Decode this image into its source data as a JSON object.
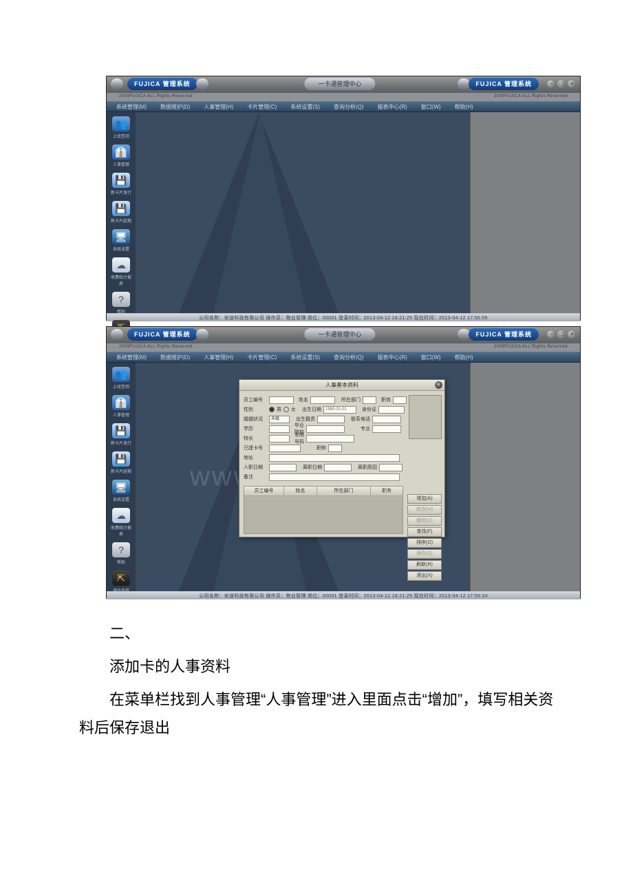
{
  "brand": "FUJICA 管理系统",
  "copyright": "2009FUJICA ALL Rights Reserved",
  "center_title": "一卡通管理中心",
  "winbuttons": {
    "min": "−",
    "max": "□",
    "close": "×"
  },
  "menus": {
    "m0": "系统管理(M)",
    "m1": "数据维护(D)",
    "m2": "人事管理(H)",
    "m3": "卡片管理(C)",
    "m4": "系统设置(S)",
    "m5": "查询分析(Q)",
    "m6": "报表中心(R)",
    "m7": "窗口(W)",
    "m8": "帮助(H)"
  },
  "sidebar": {
    "i0": {
      "glyph": "👥",
      "label": "上班签到"
    },
    "i1": {
      "glyph": "👔",
      "label": "人事管理"
    },
    "i2": {
      "glyph": "💾",
      "label": "新卡片发行"
    },
    "i3": {
      "glyph": "💾",
      "label": "新卡片延期"
    },
    "i4": {
      "glyph": "🖥",
      "label": "系统设置"
    },
    "i5": {
      "glyph": "☁",
      "label": "收费统计报表"
    },
    "i6": {
      "glyph": "?",
      "label": "帮助"
    },
    "i7": {
      "glyph": "⇱",
      "label": "退出系统"
    }
  },
  "status1": "公司名称：安道科技有限公司   操作员：物业管理   岗位：00001   登录时间：2013-04-12 18:21:25   现在时间：2013-04-12 17:56:56",
  "status2": "公司名称：安道科技有限公司   操作员：物业管理   岗位：00001   登录时间：2013-04-12 18:21:25   现在时间：2013-04-12 17:59:34",
  "watermark": "www.bdocx.com",
  "dialog": {
    "title": "人事基本资料",
    "labels": {
      "empno": "员工编号",
      "name": "姓名",
      "dept": "所在部门",
      "job": "职务",
      "sex": "性别",
      "sex_m": "男",
      "sex_f": "女",
      "birth": "出生日期",
      "birth_val": "1980-01-01",
      "idcard": "身份证",
      "marital": "婚姻状况",
      "marital_val": "未婚",
      "native": "出生籍贯",
      "phone": "联系电话",
      "degree": "学历",
      "gradfrom": "毕业院校",
      "major": "专业",
      "speciality": "特长",
      "carno": "车牌号码",
      "usecard": "已建卡号",
      "position": "职称",
      "address": "地址",
      "indate": "入职日期",
      "outdate": "离职日期",
      "outreason": "离职原因",
      "remark": "备注"
    },
    "cols": {
      "c0": "员工编号",
      "c1": "姓名",
      "c2": "所在部门",
      "c3": "职务"
    },
    "btns": {
      "add": "增加(A)",
      "mod": "修改(M)",
      "del": "删除(D)",
      "qry": "查找(F)",
      "sort": "排序(O)",
      "save": "保存(S)",
      "ref": "刷新(R)",
      "exit": "退出(X)"
    }
  },
  "doc": {
    "num": "二、",
    "p1": "添加卡的人事资料",
    "p2": "在菜单栏找到人事管理“人事管理”进入里面点击“增加”，填写相关资料后保存退出"
  }
}
